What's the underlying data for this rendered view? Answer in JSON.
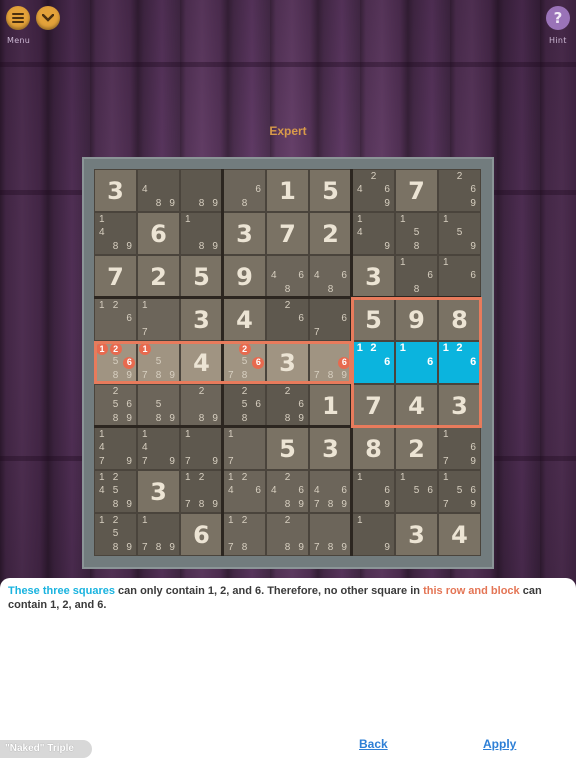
{
  "header": {
    "menu_label": "Menu",
    "hint_label": "Hint",
    "hint_glyph": "?",
    "difficulty": "Expert"
  },
  "board": {
    "cells": [
      [
        {
          "v": "3"
        },
        {
          "c": [
            "4",
            "8",
            "9"
          ]
        },
        {
          "c": [
            "8",
            "9"
          ]
        },
        {
          "c": [
            "6",
            "8"
          ]
        },
        {
          "v": "1"
        },
        {
          "v": "5"
        },
        {
          "c": [
            "2",
            "4",
            "6",
            "9"
          ]
        },
        {
          "v": "7"
        },
        {
          "c": [
            "2",
            "6",
            "9"
          ]
        }
      ],
      [
        {
          "c": [
            "1",
            "4",
            "8",
            "9"
          ]
        },
        {
          "v": "6"
        },
        {
          "c": [
            "1",
            "8",
            "9"
          ]
        },
        {
          "v": "3"
        },
        {
          "v": "7"
        },
        {
          "v": "2"
        },
        {
          "c": [
            "1",
            "4",
            "9"
          ]
        },
        {
          "c": [
            "1",
            "5",
            "8"
          ]
        },
        {
          "c": [
            "1",
            "5",
            "9"
          ]
        }
      ],
      [
        {
          "v": "7"
        },
        {
          "v": "2"
        },
        {
          "v": "5"
        },
        {
          "v": "9"
        },
        {
          "c": [
            "4",
            "6",
            "8"
          ]
        },
        {
          "c": [
            "4",
            "6",
            "8"
          ]
        },
        {
          "v": "3"
        },
        {
          "c": [
            "1",
            "6",
            "8"
          ]
        },
        {
          "c": [
            "1",
            "6"
          ]
        }
      ],
      [
        {
          "c": [
            "1",
            "2",
            "6"
          ]
        },
        {
          "c": [
            "1",
            "7"
          ]
        },
        {
          "v": "3"
        },
        {
          "v": "4"
        },
        {
          "c": [
            "2",
            "6"
          ]
        },
        {
          "c": [
            "6",
            "7"
          ]
        },
        {
          "v": "5"
        },
        {
          "v": "9"
        },
        {
          "v": "8"
        }
      ],
      [
        {
          "c": [
            "1",
            "2",
            "5",
            "6",
            "8",
            "9"
          ]
        },
        {
          "c": [
            "1",
            "5",
            "7",
            "8",
            "9"
          ]
        },
        {
          "v": "4"
        },
        {
          "c": [
            "2",
            "5",
            "6",
            "7",
            "8"
          ]
        },
        {
          "v": "3"
        },
        {
          "c": [
            "6",
            "7",
            "8",
            "9"
          ]
        },
        {
          "c": [
            "1",
            "2",
            "6"
          ]
        },
        {
          "c": [
            "1",
            "6"
          ]
        },
        {
          "c": [
            "1",
            "2",
            "6"
          ]
        }
      ],
      [
        {
          "c": [
            "2",
            "5",
            "6",
            "8",
            "9"
          ]
        },
        {
          "c": [
            "5",
            "8",
            "9"
          ]
        },
        {
          "c": [
            "2",
            "8",
            "9"
          ]
        },
        {
          "c": [
            "2",
            "5",
            "6",
            "8"
          ]
        },
        {
          "c": [
            "2",
            "6",
            "8",
            "9"
          ]
        },
        {
          "v": "1"
        },
        {
          "v": "7"
        },
        {
          "v": "4"
        },
        {
          "v": "3"
        }
      ],
      [
        {
          "c": [
            "1",
            "4",
            "9",
            "7"
          ]
        },
        {
          "c": [
            "1",
            "4",
            "7",
            "9",
            "7"
          ]
        },
        {
          "c": [
            "1",
            "7",
            "9"
          ]
        },
        {
          "c": [
            "1",
            "7"
          ]
        },
        {
          "v": "5"
        },
        {
          "v": "3"
        },
        {
          "v": "8"
        },
        {
          "v": "2"
        },
        {
          "c": [
            "1",
            "6",
            "7",
            "9"
          ]
        }
      ],
      [
        {
          "c": [
            "1",
            "2",
            "4",
            "5",
            "8",
            "9"
          ]
        },
        {
          "v": "3"
        },
        {
          "c": [
            "1",
            "2",
            "7",
            "8",
            "9"
          ]
        },
        {
          "c": [
            "1",
            "2",
            "6",
            "4"
          ]
        },
        {
          "c": [
            "2",
            "4",
            "6",
            "8",
            "9"
          ]
        },
        {
          "c": [
            "4",
            "6",
            "7",
            "8",
            "9"
          ]
        },
        {
          "c": [
            "1",
            "6",
            "9"
          ]
        },
        {
          "c": [
            "1",
            "5",
            "6"
          ]
        },
        {
          "c": [
            "1",
            "5",
            "6",
            "7",
            "9"
          ]
        }
      ],
      [
        {
          "c": [
            "1",
            "2",
            "5",
            "8",
            "9"
          ]
        },
        {
          "c": [
            "1",
            "7",
            "8",
            "9"
          ]
        },
        {
          "v": "6"
        },
        {
          "c": [
            "1",
            "2",
            "7",
            "8"
          ]
        },
        {
          "c": [
            "2",
            "8",
            "9"
          ]
        },
        {
          "c": [
            "7",
            "8",
            "9"
          ]
        },
        {
          "c": [
            "1",
            "9"
          ]
        },
        {
          "v": "3"
        },
        {
          "v": "4"
        }
      ]
    ]
  },
  "explanation": {
    "part1": "These three squares",
    "part2": " can only contain 1, 2, and 6. Therefore, no other square in ",
    "part3": "this row and block",
    "part4": " can contain 1, 2, and 6."
  },
  "footer": {
    "technique": "\"Naked\" Triple",
    "back": "Back",
    "apply": "Apply"
  },
  "colors": {
    "accent_cyan": "#19b3df",
    "accent_red": "#e47555",
    "link": "#2d7fd6"
  }
}
